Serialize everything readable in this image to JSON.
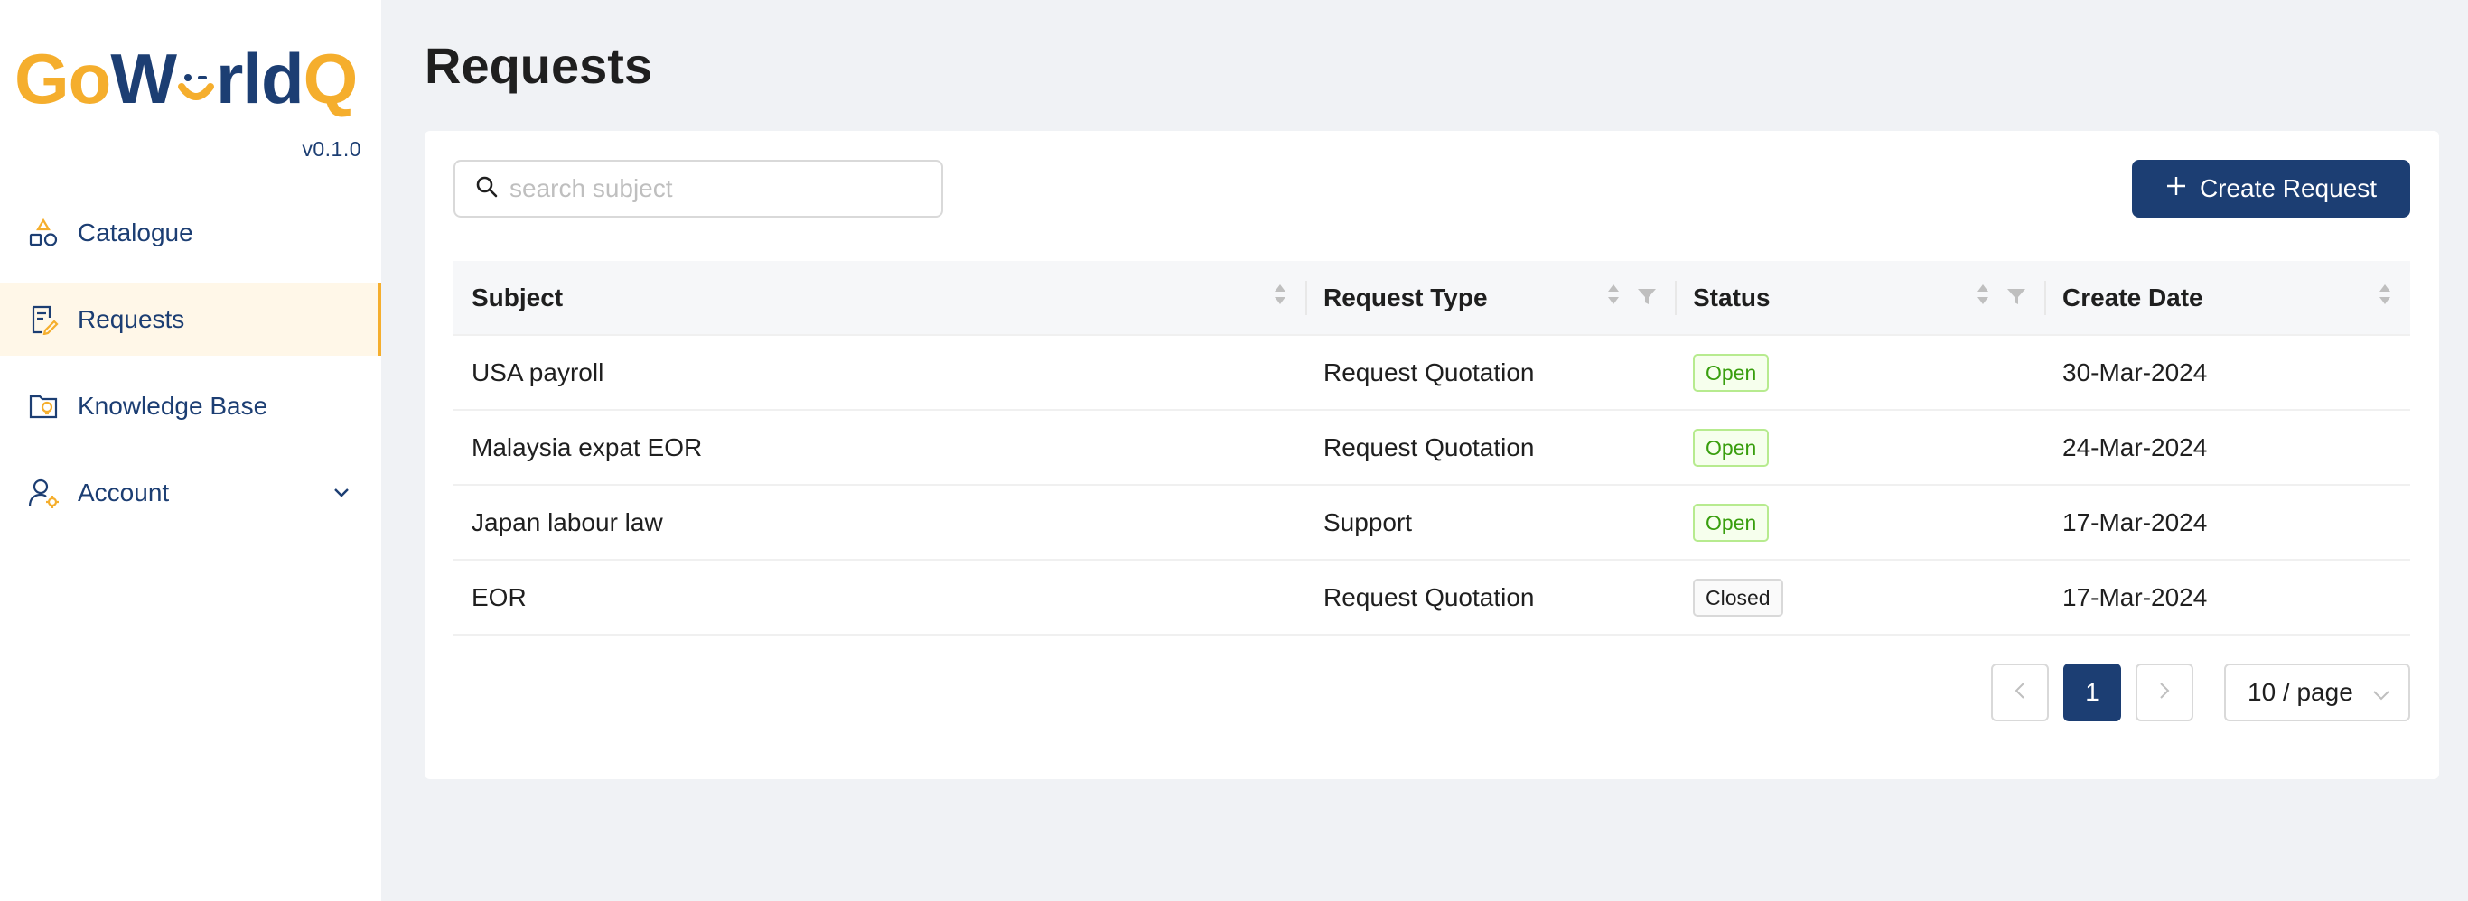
{
  "brand": {
    "logo_part1": "Go",
    "logo_part2": "W",
    "logo_part3": "rld",
    "logo_part4": "Q",
    "version": "v0.1.0",
    "colors": {
      "primary": "#1c3e73",
      "accent": "#f5ae2d"
    }
  },
  "sidebar": {
    "items": [
      {
        "label": "Catalogue",
        "icon": "catalogue-icon",
        "active": false
      },
      {
        "label": "Requests",
        "icon": "requests-icon",
        "active": true
      },
      {
        "label": "Knowledge Base",
        "icon": "knowledge-base-icon",
        "active": false
      },
      {
        "label": "Account",
        "icon": "account-icon",
        "active": false,
        "expandable": true
      }
    ]
  },
  "page": {
    "title": "Requests"
  },
  "toolbar": {
    "search_placeholder": "search subject",
    "search_value": "",
    "create_label": "Create Request"
  },
  "table": {
    "columns": [
      "Subject",
      "Request Type",
      "Status",
      "Create Date"
    ],
    "rows": [
      {
        "subject": "USA payroll",
        "type": "Request Quotation",
        "status": "Open",
        "date": "30-Mar-2024"
      },
      {
        "subject": "Malaysia expat EOR",
        "type": "Request Quotation",
        "status": "Open",
        "date": "24-Mar-2024"
      },
      {
        "subject": "Japan labour law",
        "type": "Support",
        "status": "Open",
        "date": "17-Mar-2024"
      },
      {
        "subject": "EOR",
        "type": "Request Quotation",
        "status": "Closed",
        "date": "17-Mar-2024"
      }
    ]
  },
  "pagination": {
    "current_page": "1",
    "page_size": "10 / page"
  }
}
